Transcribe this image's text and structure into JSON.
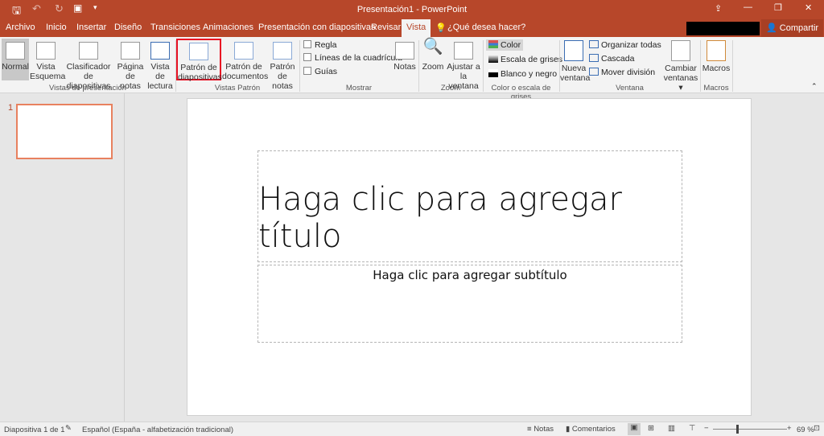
{
  "window": {
    "title": "Presentación1 - PowerPoint"
  },
  "quick_access": [
    "save-icon",
    "undo-icon",
    "redo-icon",
    "slideshow-icon",
    "customize-icon"
  ],
  "tabs": [
    "Archivo",
    "Inicio",
    "Insertar",
    "Diseño",
    "Transiciones",
    "Animaciones",
    "Presentación con diapositivas",
    "Revisar",
    "Vista"
  ],
  "active_tab": "Vista",
  "tell_me": "¿Qué desea hacer?",
  "share": "Compartir",
  "ribbon": {
    "presentation_views": {
      "label": "Vistas de presentación",
      "buttons": [
        [
          "Normal",
          ""
        ],
        [
          "Vista",
          "Esquema"
        ],
        [
          "Clasificador de",
          "diapositivas"
        ],
        [
          "Página",
          "de notas"
        ],
        [
          "Vista de",
          "lectura"
        ]
      ]
    },
    "master_views": {
      "label": "Vistas Patrón",
      "buttons": [
        [
          "Patrón de",
          "diapositivas"
        ],
        [
          "Patrón de",
          "documentos"
        ],
        [
          "Patrón",
          "de notas"
        ]
      ]
    },
    "show": {
      "label": "Mostrar",
      "checks": [
        "Regla",
        "Líneas de la cuadrícula",
        "Guías"
      ],
      "notes": "Notas"
    },
    "zoom": {
      "label": "Zoom",
      "zoom": "Zoom",
      "fit": [
        "Ajustar a",
        "la ventana"
      ]
    },
    "color": {
      "label": "Color o escala de grises",
      "items": [
        "Color",
        "Escala de grises",
        "Blanco y negro"
      ]
    },
    "window": {
      "label": "Ventana",
      "new": [
        "Nueva",
        "ventana"
      ],
      "items": [
        "Organizar todas",
        "Cascada",
        "Mover división"
      ],
      "switch": [
        "Cambiar",
        "ventanas ▾"
      ]
    },
    "macros": {
      "label": "Macros",
      "button": "Macros"
    }
  },
  "thumbnail": {
    "number": "1"
  },
  "slide": {
    "title_placeholder": "Haga clic para agregar título",
    "subtitle_placeholder": "Haga clic para agregar subtítulo"
  },
  "status": {
    "slide": "Diapositiva 1 de 1",
    "language": "Español (España - alfabetización tradicional)",
    "notes": "Notas",
    "comments": "Comentarios",
    "zoom": "69 %",
    "zoom_percent": 69
  },
  "colors": {
    "accent": "#b7472a",
    "highlight": "#e81123"
  }
}
